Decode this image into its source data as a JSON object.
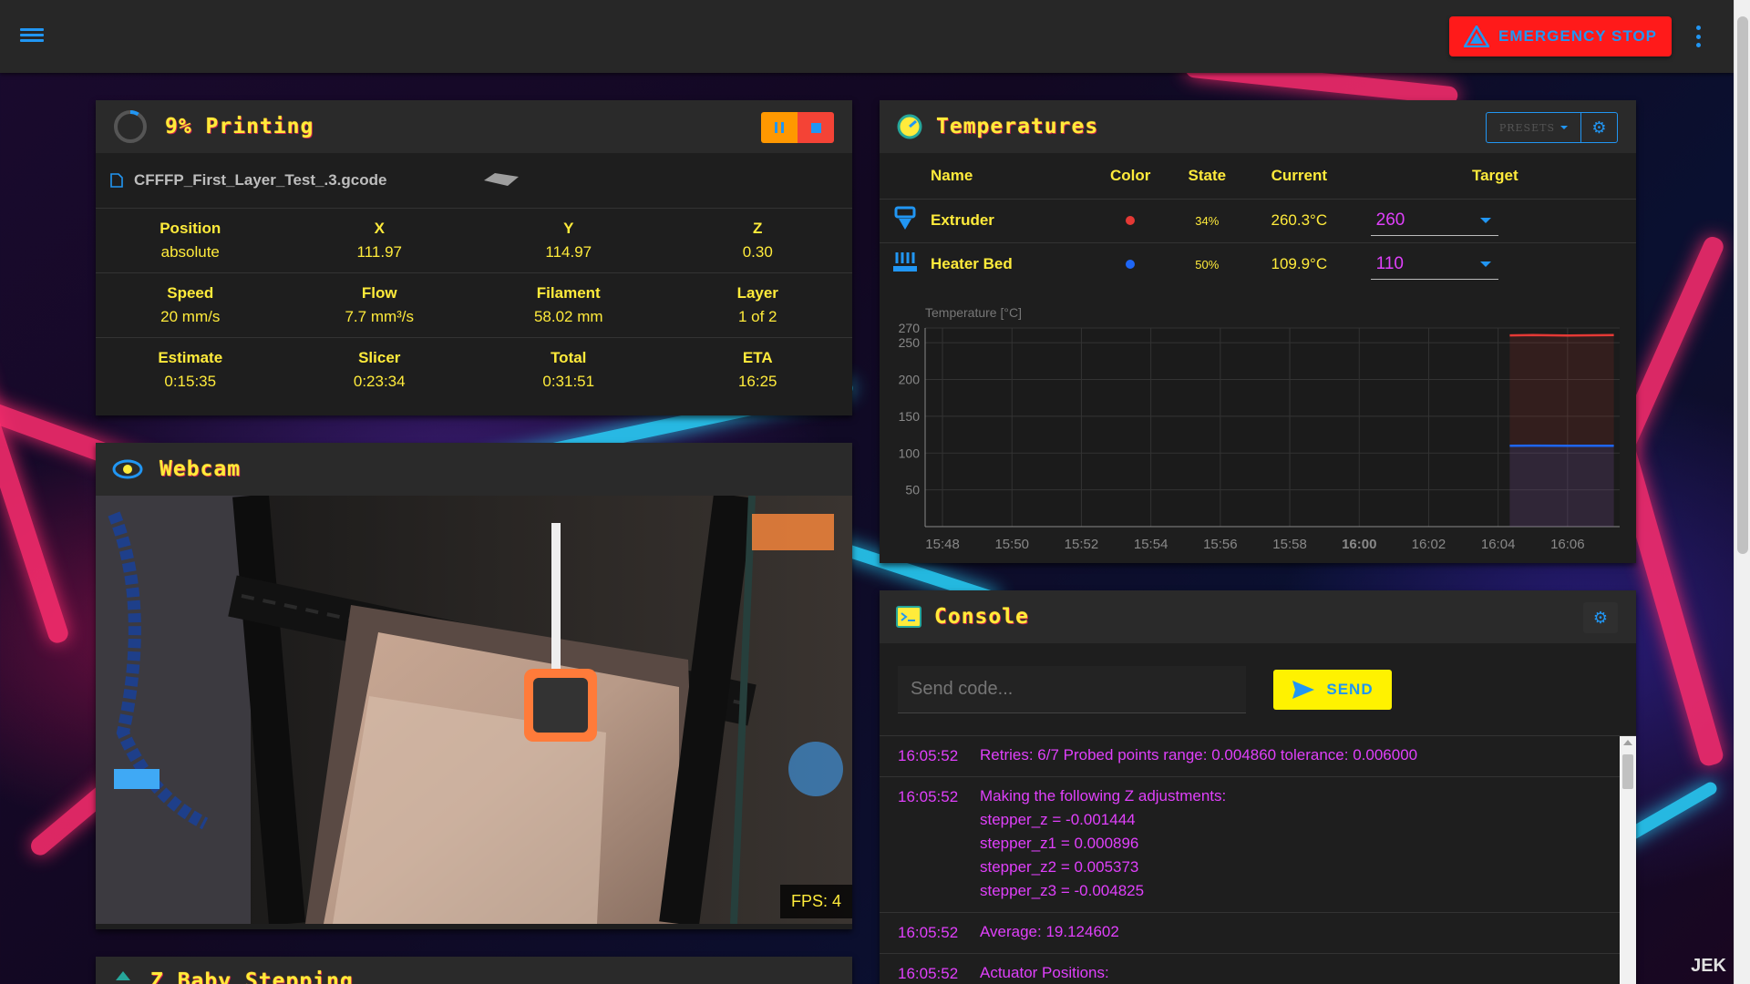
{
  "appbar": {
    "estop_label": "EMERGENCY STOP"
  },
  "status": {
    "title": "9% Printing",
    "progress": 0.09,
    "filename": "CFFFP_First_Layer_Test_.3.gcode",
    "rows": [
      [
        {
          "label": "Position",
          "value": "absolute"
        },
        {
          "label": "X",
          "value": "111.97"
        },
        {
          "label": "Y",
          "value": "114.97"
        },
        {
          "label": "Z",
          "value": "0.30"
        }
      ],
      [
        {
          "label": "Speed",
          "value": "20 mm/s"
        },
        {
          "label": "Flow",
          "value": "7.7 mm³/s"
        },
        {
          "label": "Filament",
          "value": "58.02 mm"
        },
        {
          "label": "Layer",
          "value": "1 of 2"
        }
      ],
      [
        {
          "label": "Estimate",
          "value": "0:15:35"
        },
        {
          "label": "Slicer",
          "value": "0:23:34"
        },
        {
          "label": "Total",
          "value": "0:31:51"
        },
        {
          "label": "ETA",
          "value": "16:25"
        }
      ]
    ]
  },
  "webcam": {
    "title": "Webcam",
    "fps": "FPS: 4"
  },
  "next_panel": {
    "title": "Z Baby Stepping"
  },
  "temperatures": {
    "title": "Temperatures",
    "presets_label": "PRESETS",
    "columns": [
      "Name",
      "Color",
      "State",
      "Current",
      "Target"
    ],
    "heaters": [
      {
        "name": "Extruder",
        "color": "#e53935",
        "state": "34%",
        "current": "260.3°C",
        "target": "260"
      },
      {
        "name": "Heater Bed",
        "color": "#1e66f5",
        "state": "50%",
        "current": "109.9°C",
        "target": "110"
      }
    ]
  },
  "chart_data": {
    "type": "line",
    "ylabel": "Temperature [°C]",
    "ylim": [
      0,
      270
    ],
    "yticks": [
      50,
      100,
      150,
      200,
      250,
      270
    ],
    "xticks": [
      "15:48",
      "15:50",
      "15:52",
      "15:54",
      "15:56",
      "15:58",
      "16:00",
      "16:02",
      "16:04",
      "16:06"
    ],
    "x_range": [
      "15:47:30",
      "16:07:30"
    ],
    "grid": true,
    "series": [
      {
        "name": "Extruder",
        "color": "#e53935",
        "x": [
          "16:04:20",
          "16:05",
          "16:06",
          "16:07:20"
        ],
        "values": [
          260,
          260.4,
          259.8,
          260.3
        ]
      },
      {
        "name": "Heater Bed",
        "color": "#1e66f5",
        "x": [
          "16:04:20",
          "16:05",
          "16:06",
          "16:07:20"
        ],
        "values": [
          110,
          110.1,
          109.9,
          109.9
        ]
      }
    ]
  },
  "console": {
    "title": "Console",
    "input_placeholder": "Send code...",
    "send_label": "SEND",
    "lines": [
      {
        "time": "16:05:52",
        "msg": "Retries: 6/7 Probed points range: 0.004860 tolerance: 0.006000"
      },
      {
        "time": "16:05:52",
        "msg": "Making the following Z adjustments:\nstepper_z = -0.001444\nstepper_z1 = 0.000896\nstepper_z2 = 0.005373\nstepper_z3 = -0.004825"
      },
      {
        "time": "16:05:52",
        "msg": "Average: 19.124602"
      },
      {
        "time": "16:05:52",
        "msg": "Actuator Positions:"
      }
    ]
  },
  "watermark": "JEK"
}
